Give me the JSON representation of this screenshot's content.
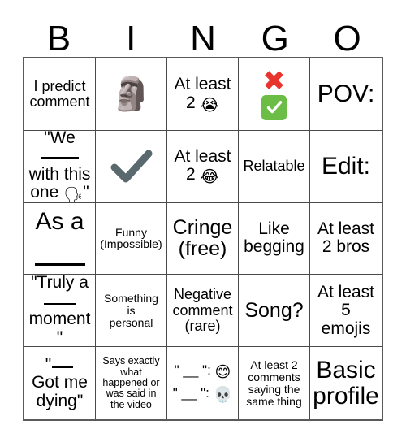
{
  "header": {
    "letters": [
      "B",
      "I",
      "N",
      "G",
      "O"
    ]
  },
  "colors": {
    "grid_border": "#5a5a5a",
    "cell_border": "#4a4a4a",
    "background": "#ffffff",
    "text": "#000000",
    "x_mark_red": "#e8342c",
    "check_green": "#6cbd45",
    "heavy_check_gray": "#59696e",
    "speaking_head_blue": "#1f7fe0"
  },
  "grid": {
    "rows": 5,
    "columns": 5,
    "cells": [
      {
        "id": "b1",
        "column": "B",
        "row": 1,
        "type": "text",
        "text": "I predict comment"
      },
      {
        "id": "i1",
        "column": "I",
        "row": 1,
        "type": "emoji",
        "emoji": "moai",
        "glyph": "🗿"
      },
      {
        "id": "n1",
        "column": "N",
        "row": 1,
        "type": "text",
        "text_line1": "At least",
        "text_line2": "2",
        "emoji": "loudly-crying-face",
        "glyph": "😭"
      },
      {
        "id": "g1",
        "column": "G",
        "row": 1,
        "type": "marks",
        "mark_top": "cross-mark",
        "mark_bottom": "check-mark-button"
      },
      {
        "id": "o1",
        "column": "O",
        "row": 1,
        "type": "text",
        "text": "POV:"
      },
      {
        "id": "b2",
        "column": "B",
        "row": 2,
        "type": "fill-in",
        "text_line1": "\"We",
        "text_line2": "with this",
        "text_line3": "one",
        "emoji": "speaking-head",
        "glyph": "🗣",
        "closing": "\""
      },
      {
        "id": "i2",
        "column": "I",
        "row": 2,
        "type": "emoji",
        "emoji": "heavy-check-mark",
        "glyph": "✔"
      },
      {
        "id": "n2",
        "column": "N",
        "row": 2,
        "type": "text",
        "text_line1": "At least",
        "text_line2": "2",
        "emoji": "face-with-tears-of-joy",
        "glyph": "😂"
      },
      {
        "id": "g2",
        "column": "G",
        "row": 2,
        "type": "text",
        "text": "Relatable"
      },
      {
        "id": "o2",
        "column": "O",
        "row": 2,
        "type": "text",
        "text": "Edit:"
      },
      {
        "id": "b3",
        "column": "B",
        "row": 3,
        "type": "fill-in",
        "text_line1": "As a",
        "text_line2": "____"
      },
      {
        "id": "i3",
        "column": "I",
        "row": 3,
        "type": "text",
        "text": "Funny\n(Impossible)"
      },
      {
        "id": "n3",
        "column": "N",
        "row": 3,
        "type": "text",
        "text": "Cringe\n(free)"
      },
      {
        "id": "g3",
        "column": "G",
        "row": 3,
        "type": "text",
        "text": "Like\nbegging"
      },
      {
        "id": "o3",
        "column": "O",
        "row": 3,
        "type": "text",
        "text": "At least\n2 bros"
      },
      {
        "id": "b4",
        "column": "B",
        "row": 4,
        "type": "fill-in",
        "text_line1": "\"Truly a",
        "text_line2": "____",
        "text_line3": "moment\""
      },
      {
        "id": "i4",
        "column": "I",
        "row": 4,
        "type": "text",
        "text": "Something\nis\npersonal"
      },
      {
        "id": "n4",
        "column": "N",
        "row": 4,
        "type": "text",
        "text": "Negative\ncomment\n(rare)"
      },
      {
        "id": "g4",
        "column": "G",
        "row": 4,
        "type": "text",
        "text": "Song?"
      },
      {
        "id": "o4",
        "column": "O",
        "row": 4,
        "type": "text",
        "text": "At least\n5\nemojis"
      },
      {
        "id": "b5",
        "column": "B",
        "row": 5,
        "type": "fill-in",
        "text_line1": "\"____",
        "text_line2": "Got me",
        "text_line3": "dying\""
      },
      {
        "id": "i5",
        "column": "I",
        "row": 5,
        "type": "text",
        "text": "Says exactly\nwhat\nhappened or\nwas said in\nthe video"
      },
      {
        "id": "n5",
        "column": "N",
        "row": 5,
        "type": "quote-emoji",
        "quote_1": "\" __ \":",
        "emoji_1": "smiling-face-with-smiling-eyes",
        "glyph_1": "😊",
        "quote_2": "\" __ \":",
        "emoji_2": "skull",
        "glyph_2": "💀"
      },
      {
        "id": "g5",
        "column": "G",
        "row": 5,
        "type": "text",
        "text": "At least 2\ncomments\nsaying the\nsame thing"
      },
      {
        "id": "o5",
        "column": "O",
        "row": 5,
        "type": "text",
        "text": "Basic\nprofile"
      }
    ]
  }
}
